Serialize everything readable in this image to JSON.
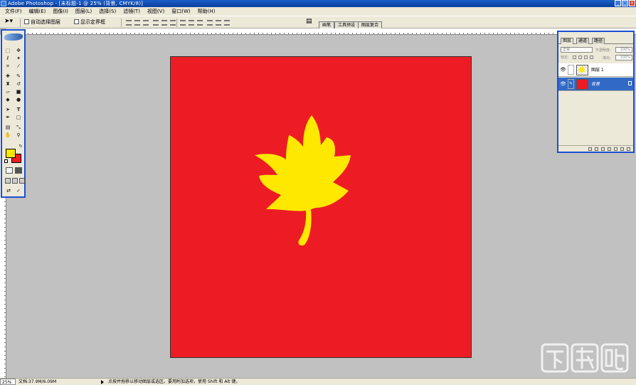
{
  "window": {
    "title": "Adobe Photoshop - [未标题-1 @ 25% (背景, CMYK/8)]",
    "controls": [
      "_",
      "□",
      "×"
    ]
  },
  "menu": [
    "文件(F)",
    "编辑(E)",
    "图像(I)",
    "图层(L)",
    "选择(S)",
    "滤镜(T)",
    "视图(V)",
    "窗口(W)",
    "帮助(H)"
  ],
  "options": {
    "auto_select_layer": "自动选择图层",
    "show_bounding_box": "显示定界框",
    "palette_tabs": [
      "画笔",
      "工具预设",
      "图层复合"
    ]
  },
  "colors": {
    "foreground": "#ffe800",
    "background": "#ed1c24",
    "canvas": "#ed1c24",
    "leaf": "#ffe800"
  },
  "layers_panel": {
    "tabs": [
      "图层",
      "通道",
      "路径"
    ],
    "blend_mode": "正常",
    "opacity_label": "不透明度:",
    "opacity": "100%",
    "lock_label": "锁定:",
    "fill_label": "填充:",
    "fill": "100%",
    "layers": [
      {
        "name": "图层 1",
        "selected": false
      },
      {
        "name": "背景",
        "selected": true
      }
    ]
  },
  "status": {
    "zoom": "25%",
    "doc_size": "文档:37.9M/6.09M",
    "hint": "点按并拖移以移动图层或选区。要用附加选项，使用 Shift 和 Alt 键。"
  },
  "watermark": {
    "text": "下载吧"
  }
}
